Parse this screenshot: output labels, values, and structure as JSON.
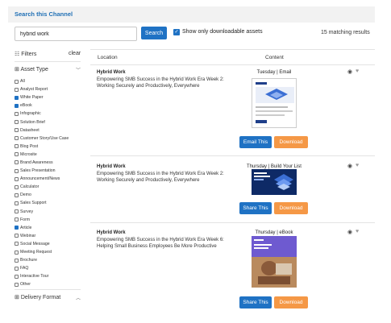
{
  "header": {
    "title": "Search this Channel"
  },
  "search": {
    "value": "hybrid work",
    "button_label": "Search",
    "downloadable_label": "Show only downloadable assets",
    "downloadable_checked": true,
    "match_count": "15 matching results"
  },
  "filters": {
    "label": "Filters",
    "clear_label": "clear",
    "asset_type_label": "Asset Type",
    "delivery_format_label": "Delivery Format",
    "items": [
      {
        "label": "All",
        "checked": false
      },
      {
        "label": "Analyst Report",
        "checked": false
      },
      {
        "label": "White Paper",
        "checked": true
      },
      {
        "label": "eBook",
        "checked": true
      },
      {
        "label": "Infographic",
        "checked": false
      },
      {
        "label": "Solution Brief",
        "checked": false
      },
      {
        "label": "Datasheet",
        "checked": false
      },
      {
        "label": "Customer Story/Use Case",
        "checked": false
      },
      {
        "label": "Blog Post",
        "checked": false
      },
      {
        "label": "Microsite",
        "checked": false
      },
      {
        "label": "Brand Awareness",
        "checked": false
      },
      {
        "label": "Sales Presentation",
        "checked": false
      },
      {
        "label": "Announcement/News",
        "checked": false
      },
      {
        "label": "Calculator",
        "checked": false
      },
      {
        "label": "Demo",
        "checked": false
      },
      {
        "label": "Sales Support",
        "checked": false
      },
      {
        "label": "Survey",
        "checked": false
      },
      {
        "label": "Form",
        "checked": false
      },
      {
        "label": "Article",
        "checked": true
      },
      {
        "label": "Webinar",
        "checked": false
      },
      {
        "label": "Social Message",
        "checked": false
      },
      {
        "label": "Meeting Request",
        "checked": false
      },
      {
        "label": "Brochure",
        "checked": false
      },
      {
        "label": "FAQ",
        "checked": false
      },
      {
        "label": "Interactive Tour",
        "checked": false
      },
      {
        "label": "Other",
        "checked": false
      }
    ]
  },
  "columns": {
    "location": "Location",
    "content": "Content"
  },
  "results": [
    {
      "title": "Hybrid Work",
      "description": "Empowering SMB Success in the Hybrid Work Era Week 2: Working Securely and Productively, Everywhere",
      "meta": "Tuesday | Email",
      "primary_label": "Email This",
      "download_label": "Download"
    },
    {
      "title": "Hybrid Work",
      "description": "Empowering SMB Success in the Hybrid Work Era Week 2: Working Securely and Productively, Everywhere",
      "meta": "Thursday | Build Your List",
      "primary_label": "Share This",
      "download_label": "Download"
    },
    {
      "title": "Hybrid Work",
      "description": "Empowering SMB Success in the Hybrid Work Era Week 6: Helping Small Business Employees Be More Productive",
      "meta": "Thursday | eBook",
      "primary_label": "Share This",
      "download_label": "Download"
    }
  ],
  "colors": {
    "primary_blue": "#1f72c4",
    "download_orange": "#f59846",
    "header_link": "#1f6fb5"
  },
  "icons": {
    "filters": "sliders-icon",
    "asset_type": "grid-icon",
    "chevron": "chevron-icon",
    "eye": "eye-icon",
    "heart": "heart-icon"
  }
}
